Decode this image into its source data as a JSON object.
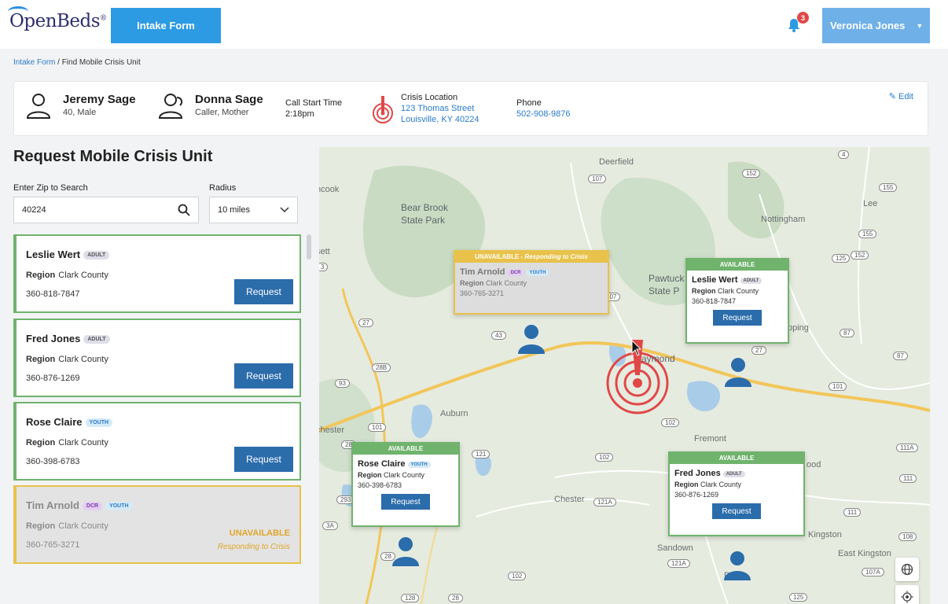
{
  "app": {
    "logo": "OpenBeds",
    "logo_mark": "®",
    "nav_tab": "Intake Form",
    "notification_count": "3",
    "user_name": "Veronica Jones"
  },
  "breadcrumb": {
    "link": "Intake Form",
    "current": "/ Find Mobile Crisis Unit"
  },
  "header": {
    "patient_name": "Jeremy Sage",
    "patient_info": "40, Male",
    "caller_name": "Donna Sage",
    "caller_info": "Caller, Mother",
    "call_start_label": "Call Start Time",
    "call_start_value": "2:18pm",
    "location_label": "Crisis Location",
    "location_line1": "123 Thomas Street",
    "location_line2": "Louisville, KY 40224",
    "phone_label": "Phone",
    "phone_value": "502-908-9876",
    "edit_label": "Edit"
  },
  "panel": {
    "title": "Request Mobile Crisis Unit",
    "zip_label": "Enter Zip to Search",
    "zip_value": "40224",
    "radius_label": "Radius",
    "radius_value": "10 miles",
    "region_label": "Region",
    "request_label": "Request",
    "units": [
      {
        "name": "Leslie Wert",
        "tags": [
          "ADULT"
        ],
        "region": "Clark County",
        "phone": "360-818-7847",
        "status": "available"
      },
      {
        "name": "Fred Jones",
        "tags": [
          "ADULT"
        ],
        "region": "Clark County",
        "phone": "360-876-1269",
        "status": "available"
      },
      {
        "name": "Rose Claire",
        "tags": [
          "YOUTH"
        ],
        "region": "Clark County",
        "phone": "360-398-6783",
        "status": "available"
      },
      {
        "name": "Tim Arnold",
        "tags": [
          "DCR",
          "YOUTH"
        ],
        "region": "Clark County",
        "phone": "360-765-3271",
        "status": "unavailable",
        "status_label": "UNAVAILABLE",
        "status_detail": "Responding to Crisis"
      }
    ]
  },
  "map": {
    "available_label": "AVAILABLE",
    "unavailable_label": "UNAVAILABLE -",
    "unavailable_detail": "Responding to Crisis",
    "places": [
      "Deerfield",
      "Bear Brook",
      "State Park",
      "Nottingham",
      "Lee",
      "Pawtuck",
      "State P",
      "aymond",
      "Auburn",
      "chester",
      "Fremont",
      "Chester",
      "Sandown",
      "Kingston",
      "East Kingston",
      "ncook",
      "sett",
      "pping",
      "ood",
      "Dan"
    ],
    "routes": [
      "107",
      "152",
      "155",
      "155",
      "125",
      "152",
      "27",
      "3",
      "28B",
      "93",
      "43",
      "101",
      "27",
      "87",
      "87",
      "101",
      "102",
      "121",
      "102",
      "121A",
      "111A",
      "111",
      "111",
      "108",
      "107A",
      "121A",
      "102",
      "28",
      "128",
      "28",
      "125",
      "4",
      "3A",
      "293",
      "28",
      "107"
    ]
  }
}
